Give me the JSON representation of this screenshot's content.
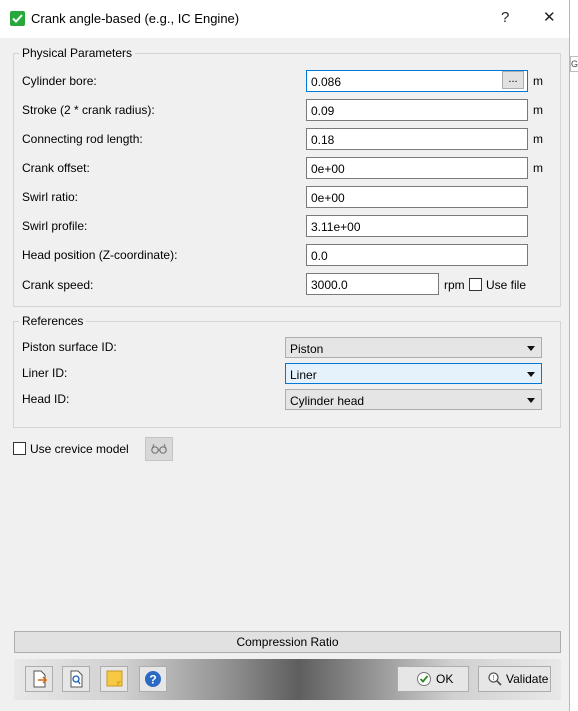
{
  "window": {
    "title": "Crank angle-based (e.g., IC Engine)",
    "help_label": "?",
    "close_label": "✕"
  },
  "physical": {
    "legend": "Physical Parameters",
    "fields": {
      "bore": {
        "label": "Cylinder bore:",
        "value": "0.086",
        "unit": "m"
      },
      "stroke": {
        "label": "Stroke (2 * crank radius):",
        "value": "0.09",
        "unit": "m"
      },
      "rod": {
        "label": "Connecting rod length:",
        "value": "0.18",
        "unit": "m"
      },
      "offset": {
        "label": "Crank offset:",
        "value": "0e+00",
        "unit": "m"
      },
      "swirl_ratio": {
        "label": "Swirl ratio:",
        "value": "0e+00"
      },
      "swirl_profile": {
        "label": "Swirl profile:",
        "value": "3.11e+00"
      },
      "head_pos": {
        "label": "Head position (Z-coordinate):",
        "value": "0.0"
      },
      "speed": {
        "label": "Crank speed:",
        "value": "3000.0",
        "unit": "rpm"
      }
    },
    "browse_label": "...",
    "use_file_label": "Use file"
  },
  "references": {
    "legend": "References",
    "piston": {
      "label": "Piston surface ID:",
      "value": "Piston"
    },
    "liner": {
      "label": "Liner ID:",
      "value": "Liner"
    },
    "head": {
      "label": "Head ID:",
      "value": "Cylinder head"
    }
  },
  "crevice": {
    "label": "Use crevice model",
    "checked": false
  },
  "compression_label": "Compression Ratio",
  "buttons": {
    "ok": "OK",
    "validate": "Validate"
  },
  "edge_text": "G",
  "colors": {
    "accent": "#0078d7",
    "title_icon": "#27a83b",
    "dialog_bg": "#f0f0f0"
  }
}
